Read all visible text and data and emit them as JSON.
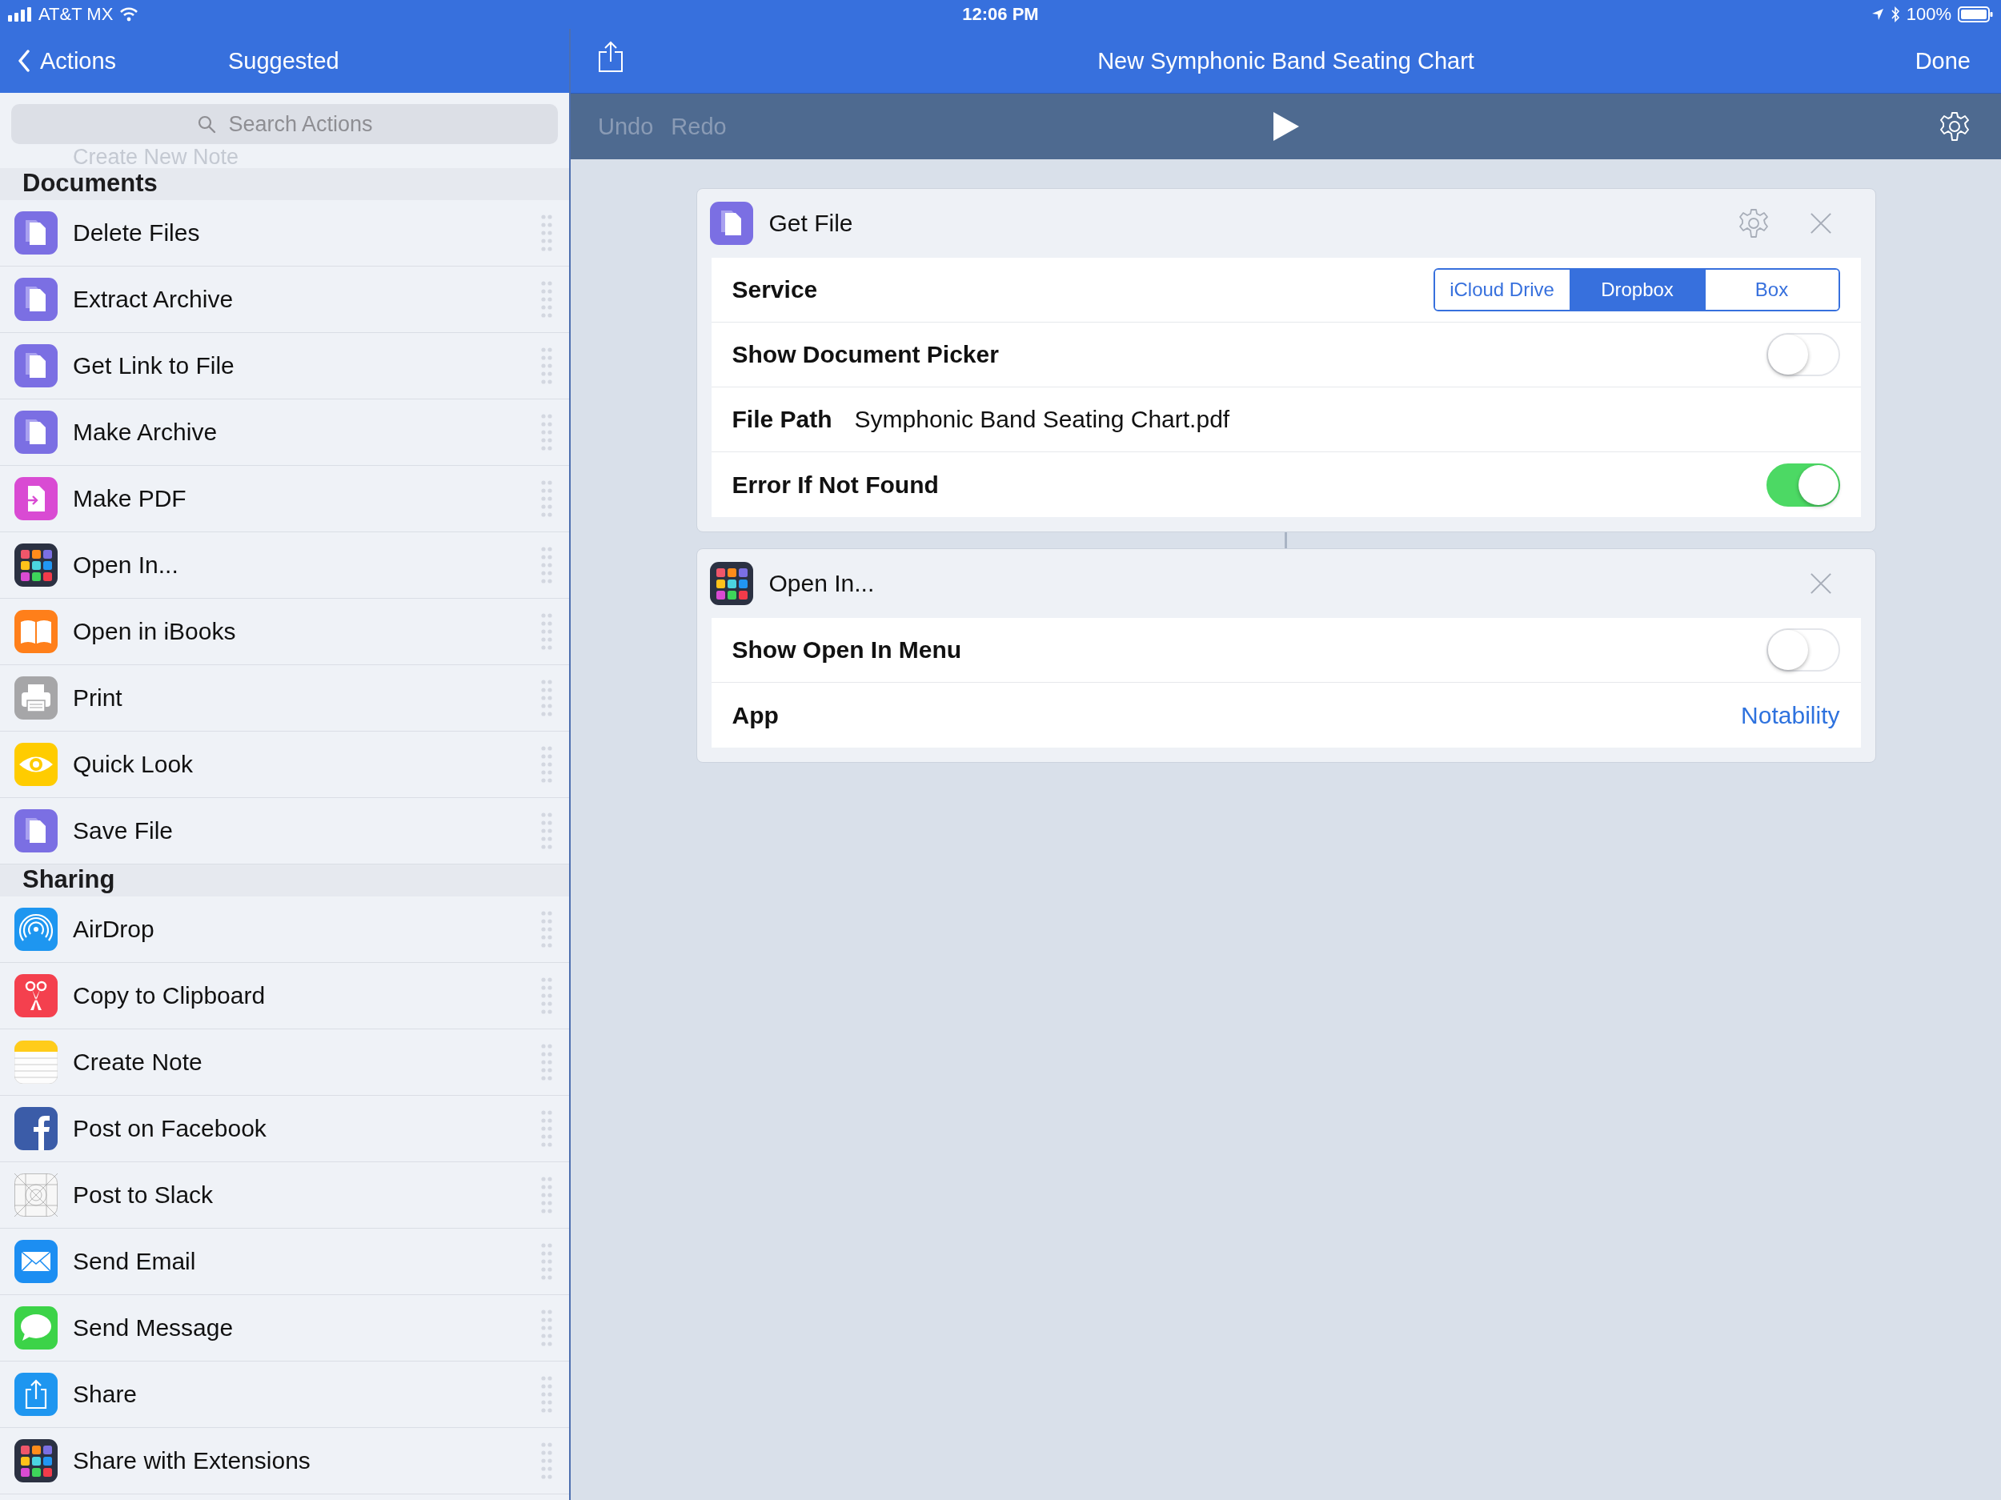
{
  "status_bar": {
    "carrier": "AT&T MX",
    "time": "12:06 PM",
    "battery": "100%"
  },
  "sidebar": {
    "back_label": "Actions",
    "title": "Suggested",
    "search": {
      "placeholder": "Search Actions"
    },
    "scrolled_text": "Create New Note",
    "sections": [
      {
        "title": "Documents",
        "items": [
          {
            "label": "Delete Files",
            "kind": "files"
          },
          {
            "label": "Extract Archive",
            "kind": "files"
          },
          {
            "label": "Get Link to File",
            "kind": "files"
          },
          {
            "label": "Make Archive",
            "kind": "files"
          },
          {
            "label": "Make PDF",
            "kind": "pdf"
          },
          {
            "label": "Open In...",
            "kind": "apps"
          },
          {
            "label": "Open in iBooks",
            "kind": "books"
          },
          {
            "label": "Print",
            "kind": "print"
          },
          {
            "label": "Quick Look",
            "kind": "eye"
          },
          {
            "label": "Save File",
            "kind": "files"
          }
        ]
      },
      {
        "title": "Sharing",
        "items": [
          {
            "label": "AirDrop",
            "kind": "airdrop"
          },
          {
            "label": "Copy to Clipboard",
            "kind": "scissors"
          },
          {
            "label": "Create Note",
            "kind": "note"
          },
          {
            "label": "Post on Facebook",
            "kind": "facebook"
          },
          {
            "label": "Post to Slack",
            "kind": "grid"
          },
          {
            "label": "Send Email",
            "kind": "mail"
          },
          {
            "label": "Send Message",
            "kind": "message"
          },
          {
            "label": "Share",
            "kind": "share"
          },
          {
            "label": "Share with Extensions",
            "kind": "apps"
          }
        ]
      }
    ]
  },
  "editor": {
    "title": "New Symphonic Band Seating Chart",
    "done": "Done",
    "undo": {
      "label": "Undo",
      "disabled": true
    },
    "redo": {
      "label": "Redo",
      "disabled": true
    },
    "cards": [
      {
        "title": "Get File",
        "kind": "files",
        "has_settings": true,
        "rows": [
          {
            "kind": "segmented",
            "label": "Service",
            "options": [
              {
                "label": "iCloud Drive",
                "selected": false
              },
              {
                "label": "Dropbox",
                "selected": true
              },
              {
                "label": "Box",
                "selected": false
              }
            ]
          },
          {
            "kind": "toggle",
            "label": "Show Document Picker",
            "on": false
          },
          {
            "kind": "text",
            "label": "File Path",
            "value": "Symphonic Band Seating Chart.pdf"
          },
          {
            "kind": "toggle",
            "label": "Error If Not Found",
            "on": true
          }
        ]
      },
      {
        "title": "Open In...",
        "kind": "apps",
        "has_settings": false,
        "rows": [
          {
            "kind": "toggle",
            "label": "Show Open In Menu",
            "on": false
          },
          {
            "kind": "link",
            "label": "App",
            "value": "Notability"
          }
        ]
      }
    ]
  }
}
